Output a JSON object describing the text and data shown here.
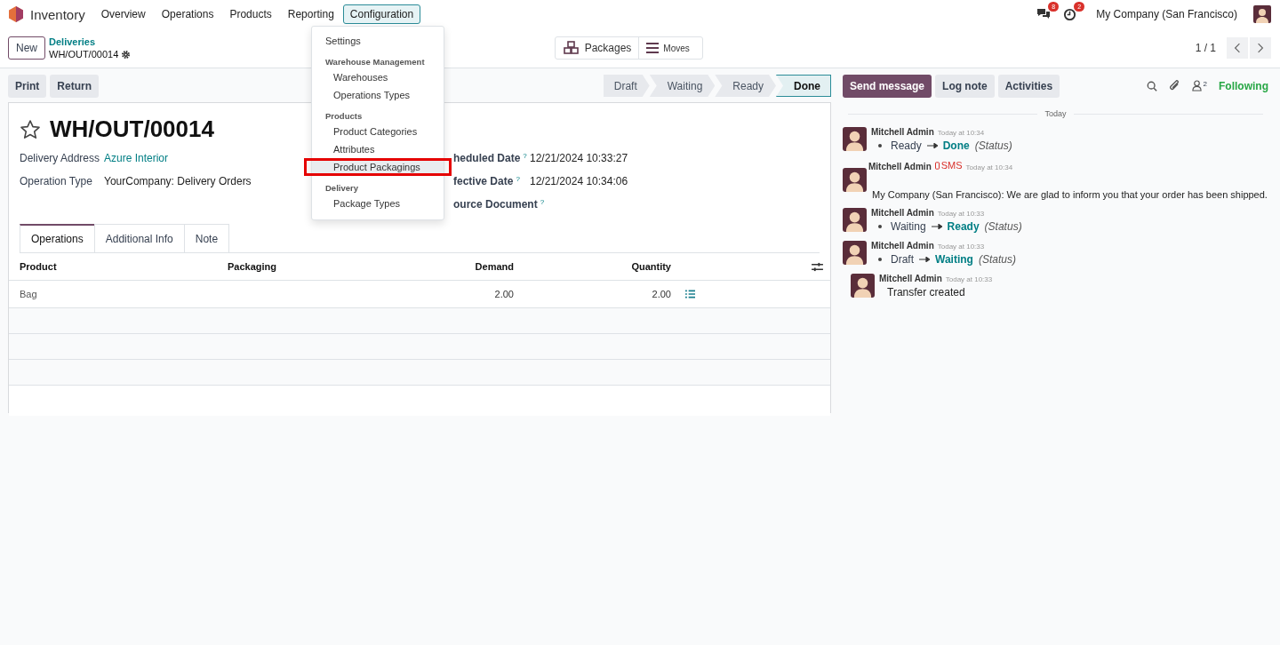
{
  "navbar": {
    "app": "Inventory",
    "menu": [
      {
        "label": "Overview",
        "selected": false
      },
      {
        "label": "Operations",
        "selected": false
      },
      {
        "label": "Products",
        "selected": false
      },
      {
        "label": "Reporting",
        "selected": false
      },
      {
        "label": "Configuration",
        "selected": true
      }
    ],
    "messages_badge": "8",
    "activities_badge": "2",
    "company": "My Company (San Francisco)"
  },
  "control_panel": {
    "new_button": "New",
    "breadcrumb": "Deliveries",
    "record": "WH/OUT/00014",
    "smart_buttons": [
      "Packages",
      "Moves"
    ],
    "pager": "1 / 1"
  },
  "actions": [
    "Print",
    "Return"
  ],
  "statusbar": [
    {
      "label": "Draft",
      "selected": false
    },
    {
      "label": "Waiting",
      "selected": false
    },
    {
      "label": "Ready",
      "selected": false
    },
    {
      "label": "Done",
      "selected": true
    }
  ],
  "form": {
    "title": "WH/OUT/00014",
    "starred": false,
    "fields_left": [
      {
        "label": "Delivery Address",
        "value": "Azure Interior",
        "kind": "link"
      },
      {
        "label": "Operation Type",
        "value": "YourCompany: Delivery Orders",
        "kind": "text"
      }
    ],
    "fields_right": [
      {
        "label": "heduled Date",
        "help": "?",
        "value": "12/21/2024 10:33:27"
      },
      {
        "label": "fective Date",
        "help": "?",
        "value": "12/21/2024 10:34:06"
      },
      {
        "label": "ource Document",
        "help": "?"
      }
    ],
    "tabs": [
      {
        "label": "Operations",
        "selected": true
      },
      {
        "label": "Additional Info",
        "selected": false
      },
      {
        "label": "Note",
        "selected": false
      }
    ],
    "table": {
      "columns": [
        "Product",
        "Packaging",
        "Demand",
        "Quantity"
      ],
      "rows": [
        {
          "product": "Bag",
          "demand": "2.00",
          "quantity": "2.00"
        }
      ]
    }
  },
  "dropdown": {
    "items": [
      {
        "kind": "item",
        "label": "Settings",
        "highlighted": false
      },
      {
        "kind": "header",
        "label": "Warehouse Management"
      },
      {
        "kind": "subitem",
        "label": "Warehouses",
        "highlighted": false
      },
      {
        "kind": "subitem",
        "label": "Operations Types",
        "highlighted": false
      },
      {
        "kind": "header",
        "label": "Products"
      },
      {
        "kind": "subitem",
        "label": "Product Categories",
        "highlighted": false
      },
      {
        "kind": "subitem",
        "label": "Attributes",
        "highlighted": false
      },
      {
        "kind": "subitem",
        "label": "Product Packagings",
        "highlighted": true
      },
      {
        "kind": "header",
        "label": "Delivery"
      },
      {
        "kind": "subitem",
        "label": "Package Types",
        "highlighted": false
      }
    ]
  },
  "chatter": {
    "buttons": [
      {
        "label": "Send message",
        "selected": true
      },
      {
        "label": "Log note",
        "selected": false
      },
      {
        "label": "Activities",
        "selected": false
      }
    ],
    "followers": "2",
    "follow_state": "Following",
    "date_separator": "Today",
    "messages": [
      {
        "kind": "tracking",
        "author": "Mitchell Admin",
        "time": "Today at 10:34",
        "old": "Ready",
        "new": "Done",
        "field": "(Status)"
      },
      {
        "kind": "sms",
        "author": "Mitchell Admin",
        "channel": "SMS",
        "time": "Today at 10:34",
        "body": "My Company (San Francisco): We are glad to inform you that your order has been shipped."
      },
      {
        "kind": "tracking",
        "author": "Mitchell Admin",
        "time": "Today at 10:33",
        "old": "Waiting",
        "new": "Ready",
        "field": "(Status)"
      },
      {
        "kind": "tracking",
        "author": "Mitchell Admin",
        "time": "Today at 10:33",
        "old": "Draft",
        "new": "Waiting",
        "field": "(Status)"
      },
      {
        "kind": "note",
        "author": "Mitchell Admin",
        "time": "Today at 10:33",
        "body": "Transfer created"
      }
    ]
  }
}
